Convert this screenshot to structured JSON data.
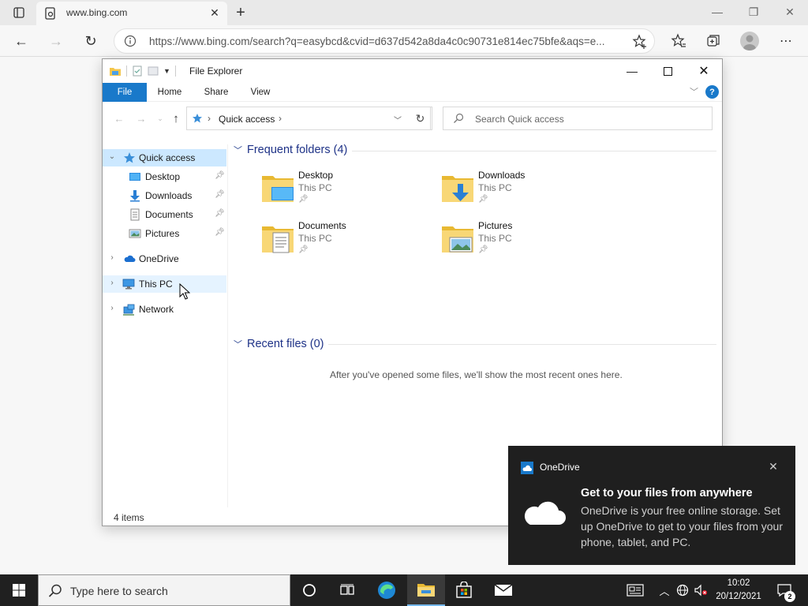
{
  "browser": {
    "tab_title": "www.bing.com",
    "url": "https://www.bing.com/search?q=easybcd&cvid=d637d542a8da4c0c90731e814ec75bfe&aqs=e..."
  },
  "explorer": {
    "title": "File Explorer",
    "ribbon_tabs": [
      "File",
      "Home",
      "Share",
      "View"
    ],
    "path": "Quick access",
    "search_placeholder": "Search Quick access",
    "nav": {
      "quick_access": "Quick access",
      "pinned": [
        "Desktop",
        "Downloads",
        "Documents",
        "Pictures"
      ],
      "onedrive": "OneDrive",
      "this_pc": "This PC",
      "network": "Network"
    },
    "frequent_title": "Frequent folders (4)",
    "folders": [
      {
        "name": "Desktop",
        "location": "This PC",
        "icon": "desktop-folder-icon"
      },
      {
        "name": "Downloads",
        "location": "This PC",
        "icon": "downloads-folder-icon"
      },
      {
        "name": "Documents",
        "location": "This PC",
        "icon": "documents-folder-icon"
      },
      {
        "name": "Pictures",
        "location": "This PC",
        "icon": "pictures-folder-icon"
      }
    ],
    "recent_title": "Recent files (0)",
    "empty_message": "After you've opened some files, we'll show the most recent ones here.",
    "status": "4 items"
  },
  "toast": {
    "app": "OneDrive",
    "title": "Get to your files from anywhere",
    "body": "OneDrive is your free online storage. Set up OneDrive to get to your files from your phone, tablet, and PC."
  },
  "taskbar": {
    "search_placeholder": "Type here to search",
    "time": "10:02",
    "date": "20/12/2021",
    "notification_count": "2"
  },
  "colors": {
    "accent": "#1979ca",
    "taskbar": "#202020",
    "selected": "#cce8ff",
    "section_title": "#1e3287"
  }
}
